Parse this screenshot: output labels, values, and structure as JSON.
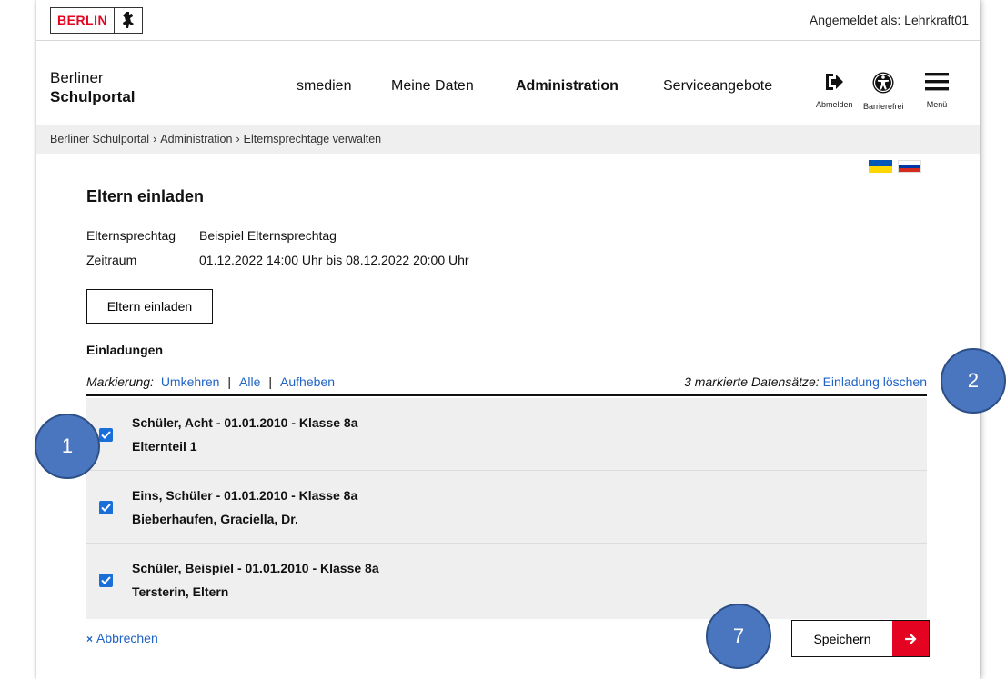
{
  "topbar": {
    "logo_text": "BERLIN",
    "logged_in": "Angemeldet als: Lehrkraft01"
  },
  "header": {
    "brand_line1": "Berliner",
    "brand_line2": "Schulportal",
    "nav": [
      {
        "label": "smedien"
      },
      {
        "label": "Meine Daten"
      },
      {
        "label": "Administration",
        "active": true
      },
      {
        "label": "Serviceangebote"
      }
    ],
    "tools": [
      {
        "icon": "logout-icon",
        "label": "Abmelden"
      },
      {
        "icon": "accessibility-icon",
        "label": "Barrierefrei"
      },
      {
        "icon": "hamburger-menu-icon",
        "label": "Menü"
      }
    ]
  },
  "breadcrumb": [
    "Berliner Schulportal",
    "Administration",
    "Elternsprechtage verwalten"
  ],
  "breadcrumb_sep": "›",
  "flags": [
    {
      "name": "ukraine-flag",
      "colors": [
        "#0057b7",
        "#ffd700"
      ]
    },
    {
      "name": "russia-flag",
      "colors": [
        "#ffffff",
        "#0039a6",
        "#d52b1e"
      ]
    }
  ],
  "page": {
    "title": "Eltern einladen",
    "info": [
      {
        "label": "Elternsprechtag",
        "value": "Beispiel Elternsprechtag"
      },
      {
        "label": "Zeitraum",
        "value": "01.12.2022 14:00 Uhr bis 08.12.2022 20:00 Uhr"
      }
    ],
    "invite_button": "Eltern einladen",
    "section_title": "Einladungen",
    "marking": {
      "label": "Markierung:",
      "links": [
        "Umkehren",
        "Alle",
        "Aufheben"
      ],
      "separator": "|",
      "selected_text": "3 markierte Datensätze:",
      "delete_link": "Einladung löschen"
    },
    "rows": [
      {
        "line1": "Schüler, Acht - 01.01.2010 - Klasse 8a",
        "line2": "Elternteil 1",
        "checked": true
      },
      {
        "line1": "Eins, Schüler - 01.01.2010 - Klasse 8a",
        "line2": "Bieberhaufen, Graciella, Dr.",
        "checked": true
      },
      {
        "line1": "Schüler, Beispiel - 01.01.2010 - Klasse 8a",
        "line2": "Tersterin, Eltern",
        "checked": true
      }
    ],
    "cancel": {
      "mark": "×",
      "label": "Abbrechen"
    },
    "save": "Speichern"
  },
  "callouts": [
    "1",
    "2",
    "7"
  ],
  "colors": {
    "brand_red": "#e40421",
    "link_blue": "#1f63c6",
    "checkbox_blue": "#1a6ed8",
    "callout_fill": "#4a76c0",
    "row_bg": "#efefef"
  }
}
